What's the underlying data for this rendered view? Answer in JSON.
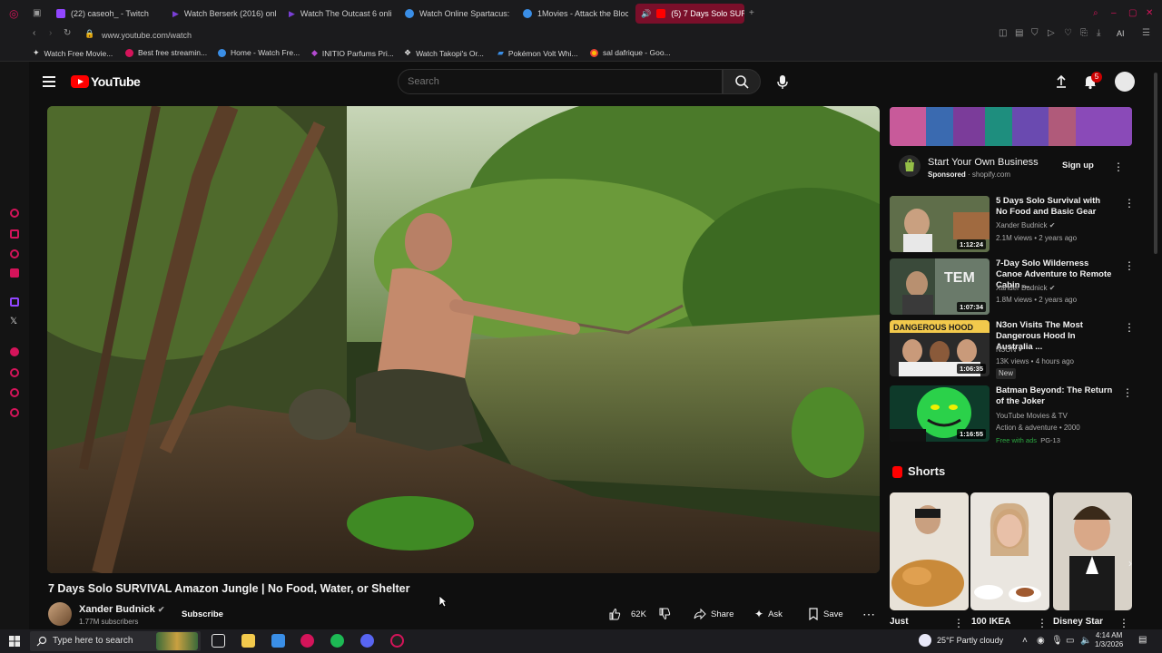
{
  "browser": {
    "tabs": [
      {
        "label": "(22) caseoh_ - Twitch",
        "color": "#9146ff"
      },
      {
        "label": "Watch Berserk (2016) onli",
        "color": "#7a3fd6"
      },
      {
        "label": "Watch The Outcast 6 onlin",
        "color": "#7a3fd6"
      },
      {
        "label": "Watch Online Spartacus: I",
        "color": "#3a8ee6"
      },
      {
        "label": "1Movies - Attack the Block",
        "color": "#3a8ee6"
      },
      {
        "label": "(5) 7 Days Solo SURVI",
        "color": "#ff0000"
      }
    ],
    "url": "www.youtube.com/watch",
    "bookmarks": [
      {
        "label": "Watch Free Movie...",
        "color": "#e0e0e0"
      },
      {
        "label": "Best free streamin...",
        "color": "#d4145a"
      },
      {
        "label": "Home - Watch Fre...",
        "color": "#3a8ee6"
      },
      {
        "label": "INITIO Parfums Pri...",
        "color": "#b34ad0"
      },
      {
        "label": "Watch Takopi's Or...",
        "color": "#dddddd"
      },
      {
        "label": "Pokémon Volt Whi...",
        "color": "#3a8ee6"
      },
      {
        "label": "sal dafrique - Goo...",
        "color": "#fbbc05"
      }
    ]
  },
  "header": {
    "logo_text": "YouTube",
    "search_placeholder": "Search",
    "notification_count": "5"
  },
  "video": {
    "title": "7 Days Solo SURVIVAL Amazon Jungle | No Food, Water, or Shelter",
    "channel": "Xander Budnick",
    "subscribers": "1.77M subscribers",
    "subscribe_label": "Subscribe",
    "likes": "62K",
    "share_label": "Share",
    "ask_label": "Ask",
    "save_label": "Save"
  },
  "ad": {
    "title": "Start Your Own Business",
    "sponsored": "Sponsored",
    "domain": "shopify.com",
    "cta": "Sign up"
  },
  "recommendations": [
    {
      "title": "5 Days Solo Survival with No Food and Basic Gear",
      "channel": "Xander Budnick",
      "meta": "2.1M views • 2 years ago",
      "duration": "1:12:24"
    },
    {
      "title": "7-Day Solo Wilderness Canoe Adventure to Remote Cabin ...",
      "channel": "Xander Budnick",
      "meta": "1.8M views • 2 years ago",
      "duration": "1:07:34"
    },
    {
      "title": "N3on Visits The Most Dangerous Hood In Australia ...",
      "channel": "N3ON",
      "meta": "13K views • 4 hours ago",
      "badge": "New",
      "duration": "1:06:35"
    },
    {
      "title": "Batman Beyond: The Return of the Joker",
      "channel": "YouTube Movies & TV",
      "meta": "Action & adventure • 2000",
      "extra_free": "Free with ads",
      "extra_rating": "PG-13",
      "duration": "1:16:55"
    }
  ],
  "shorts": {
    "heading": "Shorts",
    "items": [
      {
        "label": "Just"
      },
      {
        "label": "100 IKEA"
      },
      {
        "label": "Disney Star"
      }
    ]
  },
  "taskbar": {
    "search_placeholder": "Type here to search",
    "weather": "25°F  Partly cloudy",
    "time": "4:14 AM",
    "date": "1/3/2026"
  }
}
